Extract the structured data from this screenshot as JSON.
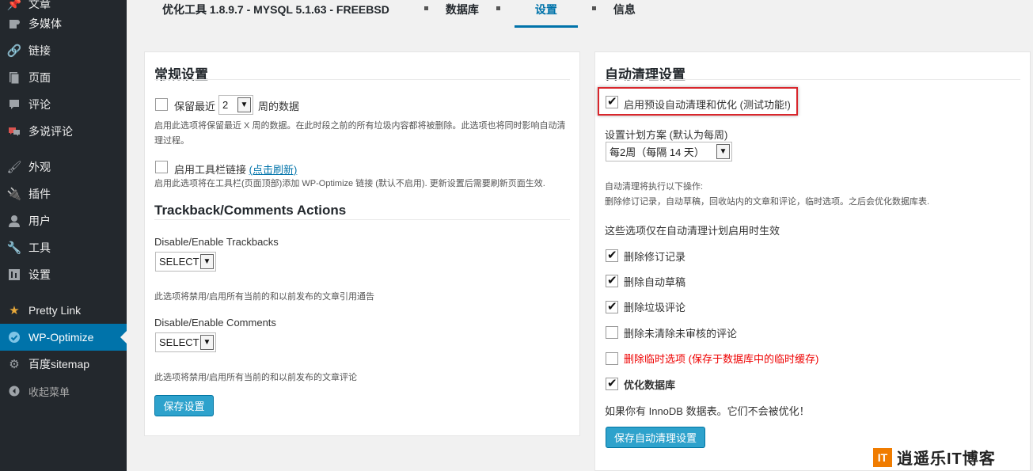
{
  "sidebar": {
    "items": [
      {
        "label": "文章",
        "icon": "pin-icon"
      },
      {
        "label": "多媒体",
        "icon": "media-icon"
      },
      {
        "label": "链接",
        "icon": "link-icon"
      },
      {
        "label": "页面",
        "icon": "page-icon"
      },
      {
        "label": "评论",
        "icon": "comment-icon"
      },
      {
        "label": "多说评论",
        "icon": "duoshuo-icon"
      },
      {
        "label": "外观",
        "icon": "brush-icon"
      },
      {
        "label": "插件",
        "icon": "plugin-icon"
      },
      {
        "label": "用户",
        "icon": "user-icon"
      },
      {
        "label": "工具",
        "icon": "wrench-icon"
      },
      {
        "label": "设置",
        "icon": "settings-icon"
      },
      {
        "label": "Pretty Link",
        "icon": "star-icon"
      },
      {
        "label": "WP-Optimize",
        "icon": "check-circle-icon"
      },
      {
        "label": "百度sitemap",
        "icon": "gear-icon"
      }
    ],
    "collapse_label": "收起菜单"
  },
  "tabs": {
    "title": "优化工具 1.8.9.7 - MYSQL 5.1.63 - FREEBSD",
    "items": [
      "数据库",
      "设置",
      "信息"
    ],
    "active": "设置"
  },
  "general": {
    "heading": "常规设置",
    "keep_label_before": "保留最近",
    "keep_weeks_value": "2",
    "keep_label_after": "周的数据",
    "keep_desc": "启用此选项将保留最近 X 周的数据。在此时段之前的所有垃圾内容都将被删除。此选项也将同时影响自动清理过程。",
    "toolbar_label": "启用工具栏链接",
    "toolbar_link": "(点击刷新)",
    "toolbar_desc": "启用此选项将在工具栏(页面顶部)添加 WP-Optimize 链接 (默认不启用). 更新设置后需要刷新页面生效."
  },
  "trackback": {
    "heading": "Trackback/Comments Actions",
    "trackbacks_label": "Disable/Enable Trackbacks",
    "trackbacks_value": "SELECT",
    "trackbacks_desc": "此选项将禁用/启用所有当前的和以前发布的文章引用通告",
    "comments_label": "Disable/Enable Comments",
    "comments_value": "SELECT",
    "comments_desc": "此选项将禁用/启用所有当前的和以前发布的文章评论",
    "save_label": "保存设置"
  },
  "auto": {
    "heading": "自动清理设置",
    "enable_label": "启用预设自动清理和优化 (测试功能!)",
    "schedule_label": "设置计划方案 (默认为每周)",
    "schedule_value": "每2周（每隔 14 天）",
    "desc_line1": "自动清理将执行以下操作:",
    "desc_line2": "删除修订记录，自动草稿，回收站内的文章和评论，临时选项。之后会优化数据库表.",
    "options_note": "这些选项仅在自动清理计划启用时生效",
    "options": [
      {
        "label": "删除修订记录",
        "checked": true
      },
      {
        "label": "删除自动草稿",
        "checked": true
      },
      {
        "label": "删除垃圾评论",
        "checked": true
      },
      {
        "label": "删除未清除未审核的评论",
        "checked": false
      },
      {
        "label": "删除临时选项 (保存于数据库中的临时缓存)",
        "checked": false
      },
      {
        "label": "优化数据库",
        "checked": true
      }
    ],
    "innodb_note": "如果你有 InnoDB 数据表。它们不会被优化！",
    "save_label": "保存自动清理设置"
  },
  "watermark": {
    "logo": "IT",
    "text": "逍遥乐IT博客"
  },
  "colors": {
    "sidebar_bg": "#23282d",
    "accent": "#0073aa",
    "button": "#2ea2cc",
    "highlight_border": "#d9262c",
    "warning_text": "#ee0000"
  }
}
